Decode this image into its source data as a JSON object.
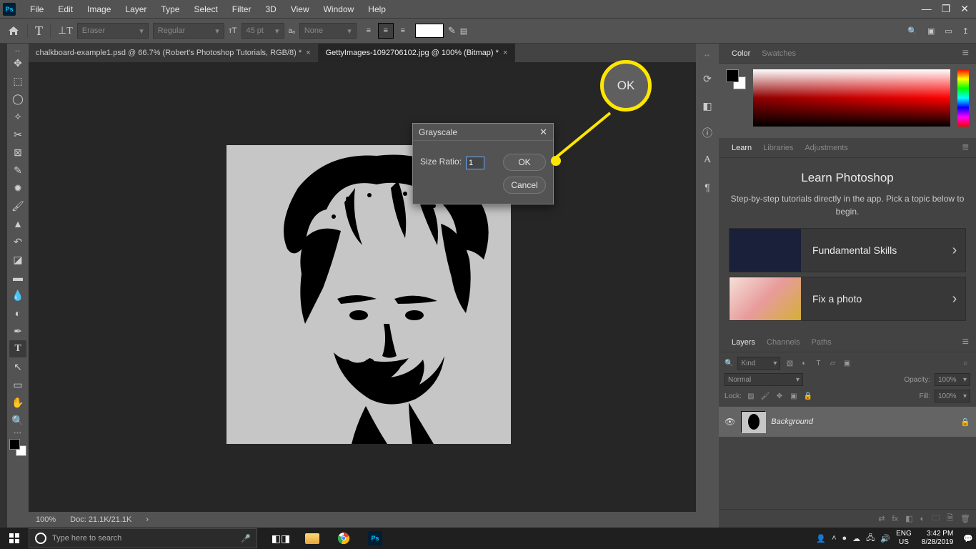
{
  "menubar": {
    "items": [
      "File",
      "Edit",
      "Image",
      "Layer",
      "Type",
      "Select",
      "Filter",
      "3D",
      "View",
      "Window",
      "Help"
    ]
  },
  "optionsbar": {
    "font_family": "Eraser",
    "font_style": "Regular",
    "font_size": "45 pt",
    "anti_alias": "None"
  },
  "tabs": [
    {
      "title": "chalkboard-example1.psd @ 66.7% (Robert's Photoshop Tutorials, RGB/8) *",
      "active": false
    },
    {
      "title": "GettyImages-1092706102.jpg @ 100% (Bitmap) *",
      "active": true
    }
  ],
  "statusbar": {
    "zoom": "100%",
    "doc": "Doc: 21.1K/21.1K"
  },
  "panels": {
    "color": {
      "tabs": [
        "Color",
        "Swatches"
      ],
      "active": 0
    },
    "learn": {
      "tabs": [
        "Learn",
        "Libraries",
        "Adjustments"
      ],
      "active": 0,
      "title": "Learn Photoshop",
      "desc": "Step-by-step tutorials directly in the app. Pick a topic below to begin.",
      "cards": [
        {
          "label": "Fundamental Skills"
        },
        {
          "label": "Fix a photo"
        }
      ]
    },
    "layers": {
      "tabs": [
        "Layers",
        "Channels",
        "Paths"
      ],
      "active": 0,
      "filter": "Kind",
      "blend": "Normal",
      "opacity_label": "Opacity:",
      "opacity": "100%",
      "lock_label": "Lock:",
      "fill_label": "Fill:",
      "fill": "100%",
      "items": [
        {
          "name": "Background"
        }
      ]
    }
  },
  "dialog": {
    "title": "Grayscale",
    "field_label": "Size Ratio:",
    "field_value": "1",
    "ok": "OK",
    "cancel": "Cancel"
  },
  "callout": {
    "label": "OK"
  },
  "taskbar": {
    "search_placeholder": "Type here to search",
    "lang1": "ENG",
    "lang2": "US",
    "time": "3:42 PM",
    "date": "8/28/2019"
  }
}
